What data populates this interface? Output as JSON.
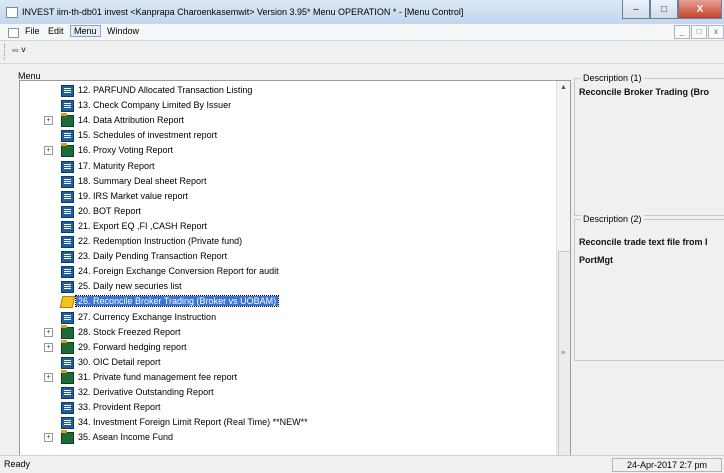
{
  "window": {
    "title": "INVEST  iim-th-db01 invest <Kanprapa Charoenkasemwit> Version 3.95* Menu OPERATION * - [Menu Control]",
    "buttons": [
      "–",
      "□",
      "X"
    ]
  },
  "menubar": {
    "items": [
      "File",
      "Edit",
      "Menu",
      "Window"
    ],
    "mdi_buttons": [
      "_",
      "□",
      "x"
    ]
  },
  "toolbar": {
    "button_label": "▫▫ ˅"
  },
  "tree": {
    "label": "Menu",
    "items": [
      {
        "text": "12. PARFUND Allocated Transaction Listing",
        "type": "doc",
        "expandable": false
      },
      {
        "text": "13. Check Company Limited By Issuer",
        "type": "doc",
        "expandable": false
      },
      {
        "text": "14. Data Attribution Report",
        "type": "folder",
        "expandable": true
      },
      {
        "text": "15. Schedules of investment report",
        "type": "doc",
        "expandable": false
      },
      {
        "text": "16. Proxy Voting Report",
        "type": "folder",
        "expandable": true
      },
      {
        "text": "17. Maturity Report",
        "type": "doc",
        "expandable": false
      },
      {
        "text": "18. Summary Deal sheet Report",
        "type": "doc",
        "expandable": false
      },
      {
        "text": "19. IRS Market value report",
        "type": "doc",
        "expandable": false
      },
      {
        "text": "20. BOT Report",
        "type": "doc",
        "expandable": false
      },
      {
        "text": "21. Export EQ ,FI ,CASH Report",
        "type": "doc",
        "expandable": false
      },
      {
        "text": "22. Redemption Instruction (Private fund)",
        "type": "doc",
        "expandable": false
      },
      {
        "text": "23. Daily Pending Transaction Report",
        "type": "doc",
        "expandable": false
      },
      {
        "text": "24. Foreign Exchange Conversion Report for audit",
        "type": "doc",
        "expandable": false
      },
      {
        "text": "25. Daily new securies list",
        "type": "doc",
        "expandable": false
      },
      {
        "text": "26. Reconcile Broker Trading (Broker vs UOBAM)",
        "type": "run",
        "expandable": false,
        "selected": true
      },
      {
        "text": "27. Currency Exchange Instruction",
        "type": "doc",
        "expandable": false
      },
      {
        "text": "28. Stock Freezed Report",
        "type": "folder",
        "expandable": true
      },
      {
        "text": "29. Forward hedging report",
        "type": "folder",
        "expandable": true
      },
      {
        "text": "30. OIC Detail report",
        "type": "doc",
        "expandable": false
      },
      {
        "text": "31. Private fund management fee report",
        "type": "folder",
        "expandable": true
      },
      {
        "text": "32. Derivative Outstanding Report",
        "type": "doc",
        "expandable": false
      },
      {
        "text": "33. Provident Report",
        "type": "doc",
        "expandable": false
      },
      {
        "text": "34. Investment Foreign Limit Report (Real Time) **NEW**",
        "type": "doc",
        "expandable": false
      },
      {
        "text": "35. Asean Income Fund",
        "type": "folder",
        "expandable": true
      }
    ]
  },
  "desc1": {
    "label": "Description (1)",
    "text": "Reconcile Broker Trading (Bro"
  },
  "desc2": {
    "label": "Description (2)",
    "line1": "Reconcile trade text file from I",
    "line2": "PortMgt"
  },
  "status": {
    "ready": "Ready",
    "datetime": "24-Apr-2017 2:7 pm"
  }
}
